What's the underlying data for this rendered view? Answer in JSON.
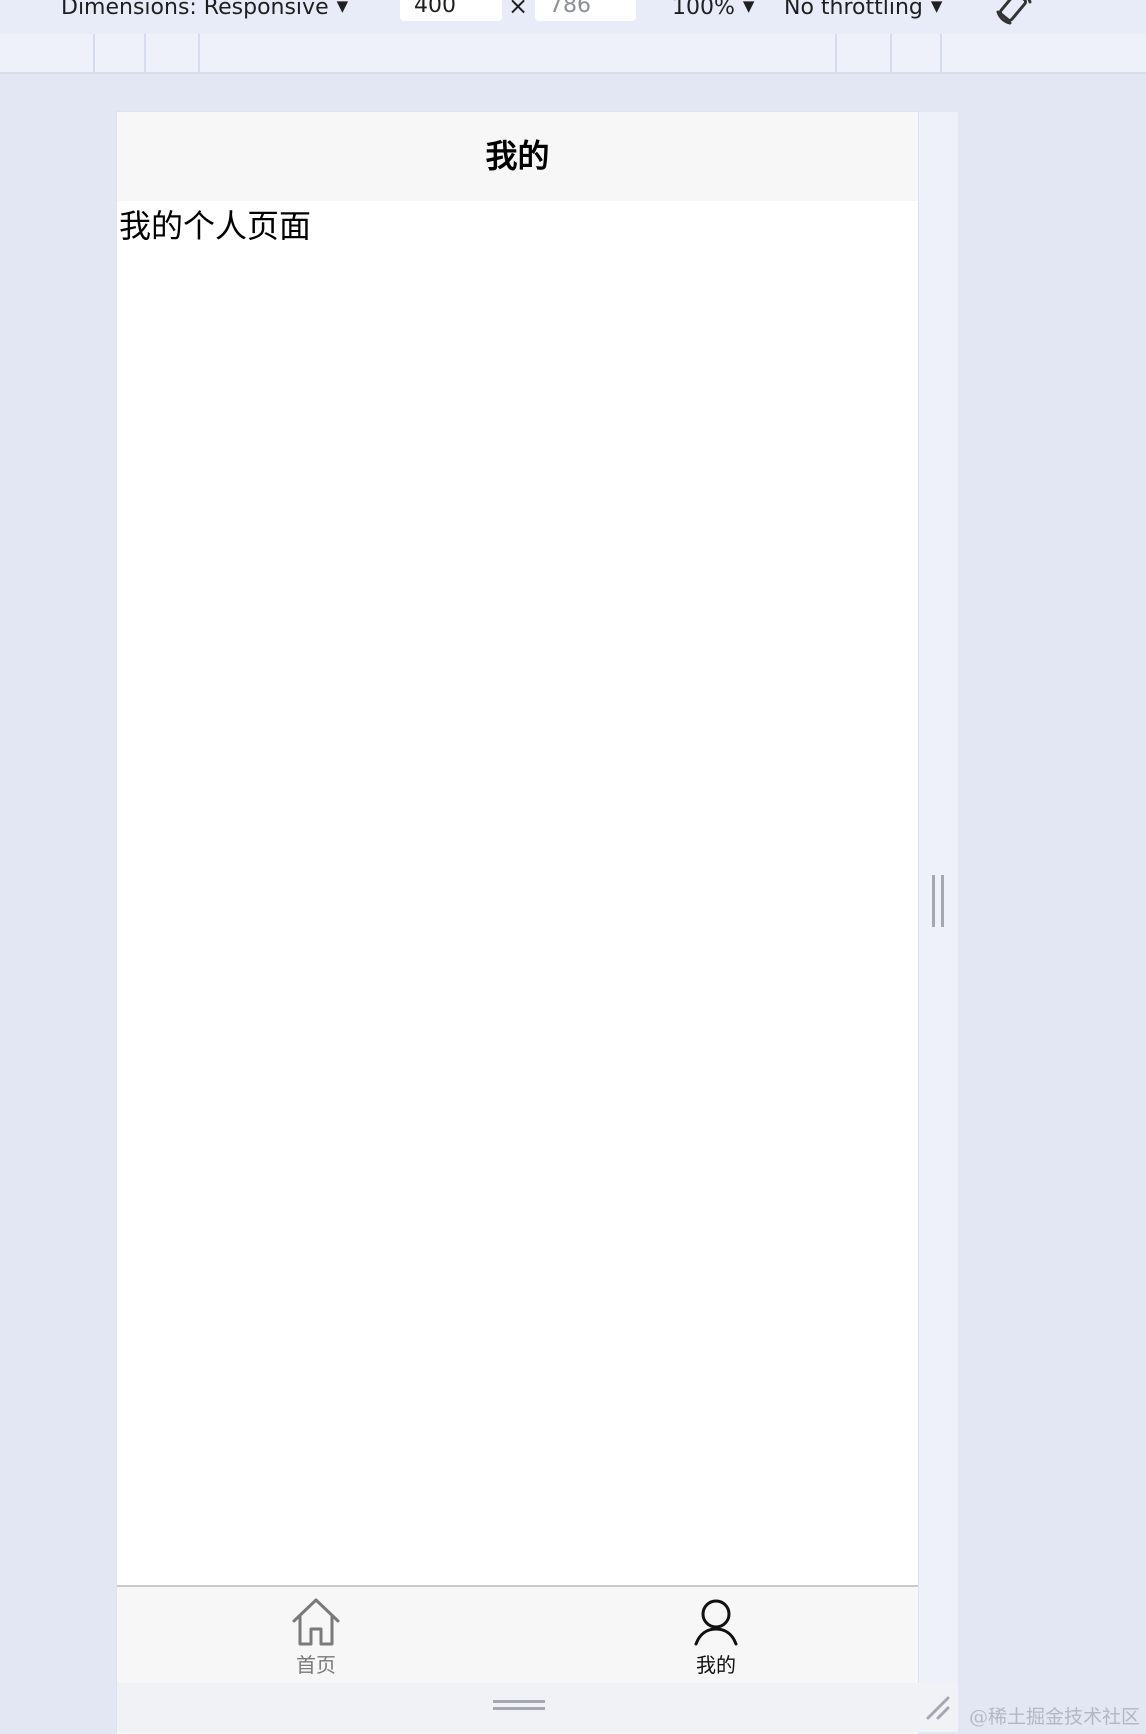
{
  "devtools": {
    "dimensions_label": "Dimensions: Responsive",
    "width_value": "400",
    "times_symbol": "×",
    "height_placeholder": "786",
    "zoom_label": "100%",
    "throttling_label": "No throttling",
    "caret": "▼",
    "rotate_icon": "rotate-icon"
  },
  "app": {
    "nav_title": "我的",
    "page_text": "我的个人页面",
    "tabs": [
      {
        "label": "首页",
        "icon": "home-icon",
        "active": false
      },
      {
        "label": "我的",
        "icon": "user-icon",
        "active": true
      }
    ]
  },
  "watermark": "@稀土掘金技术社区",
  "colors": {
    "canvas_bg": "#e3e7f3",
    "nav_bg": "#f7f7f7",
    "inactive_tab": "#7a7a7a",
    "active_tab": "#111111"
  }
}
